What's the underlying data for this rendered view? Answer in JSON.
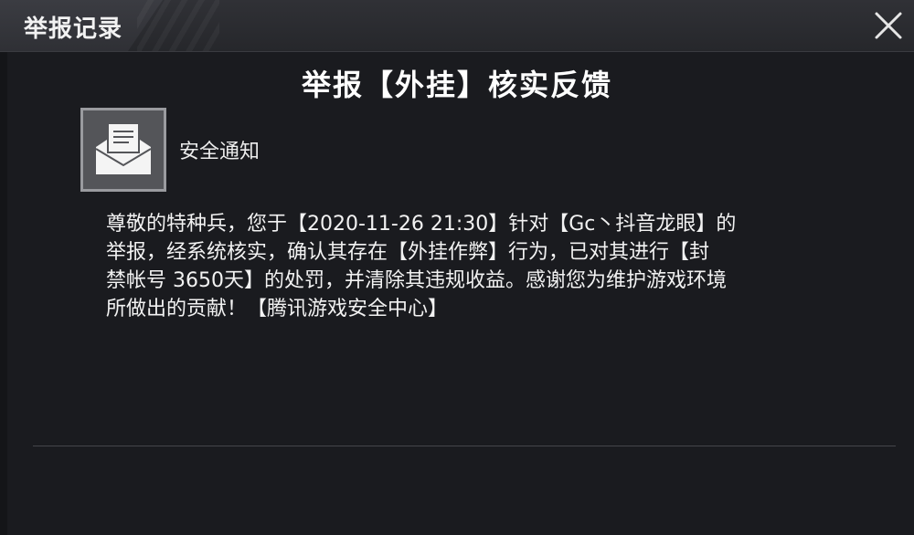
{
  "window": {
    "title": "举报记录",
    "close_icon": "close-icon"
  },
  "report": {
    "heading": "举报【外挂】核实反馈",
    "notice_icon": "mail-icon",
    "notice_title": "安全通知",
    "message": "尊敬的特种兵，您于【2020-11-26 21:30】针对【Gc丶抖音龙眼】的\n举报，经系统核实，确认其存在【外挂作弊】行为，已对其进行【封\n禁帐号 3650天】的处罚，并清除其违规收益。感谢您为维护游戏环境\n所做出的贡献！【腾讯游戏安全中心】"
  },
  "colors": {
    "background": "#1a1b1f",
    "titlebar": "#2c2d32",
    "text": "#f2f2f2",
    "icon_box": "#545559"
  }
}
